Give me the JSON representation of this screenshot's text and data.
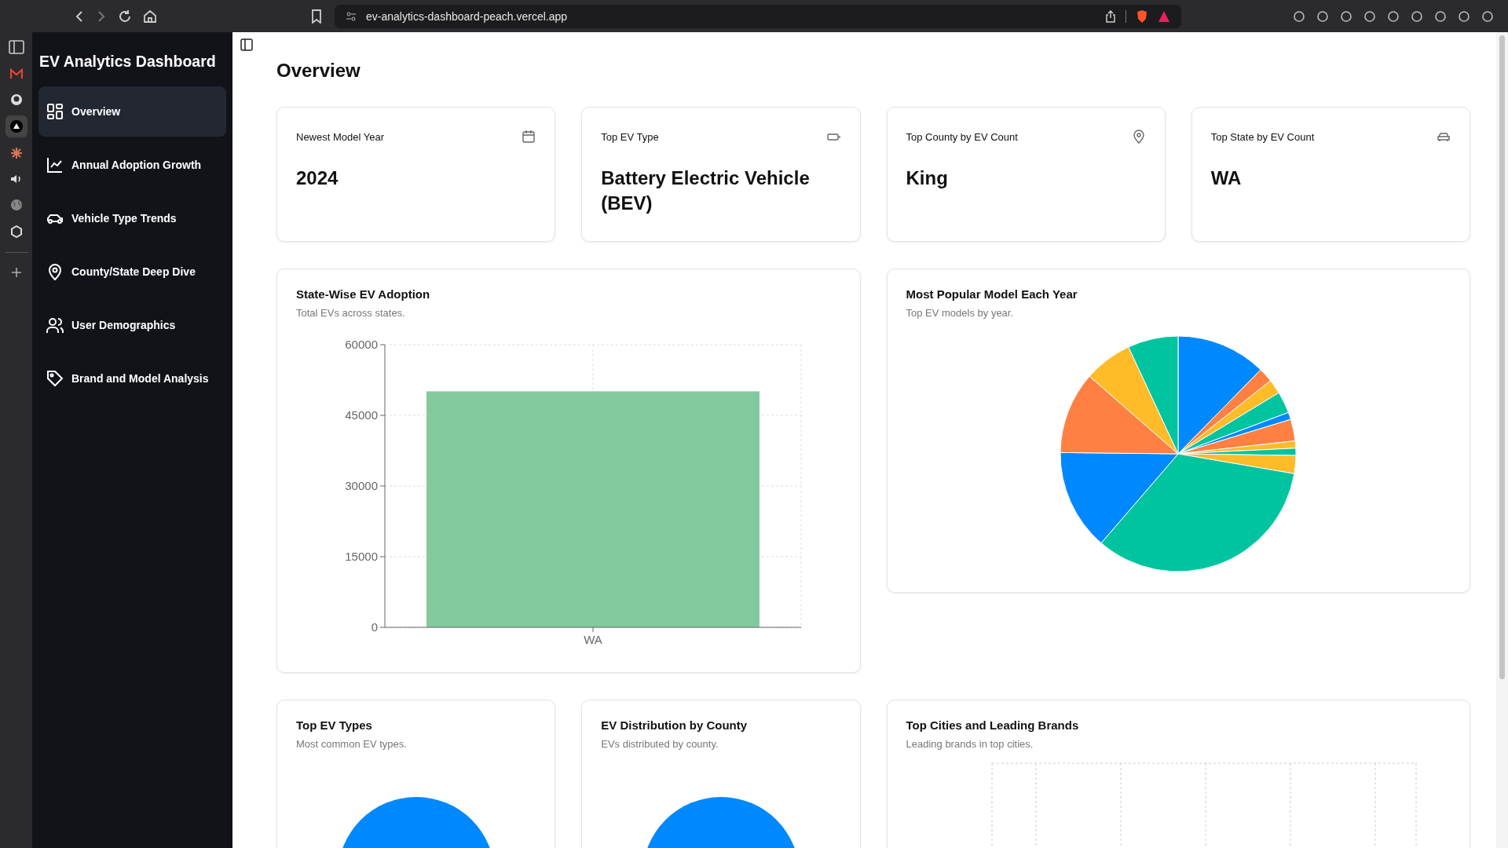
{
  "browser": {
    "url": "ev-analytics-dashboard-peach.vercel.app"
  },
  "sidebar": {
    "title": "EV Analytics Dashboard",
    "items": [
      {
        "label": "Overview",
        "selected": true
      },
      {
        "label": "Annual Adoption Growth",
        "selected": false
      },
      {
        "label": "Vehicle Type Trends",
        "selected": false
      },
      {
        "label": "County/State Deep Dive",
        "selected": false
      },
      {
        "label": "User Demographics",
        "selected": false
      },
      {
        "label": "Brand and Model Analysis",
        "selected": false
      }
    ]
  },
  "page": {
    "title": "Overview"
  },
  "stats": [
    {
      "label": "Newest Model Year",
      "value": "2024"
    },
    {
      "label": "Top EV Type",
      "value": "Battery Electric Vehicle (BEV)"
    },
    {
      "label": "Top County by EV Count",
      "value": "King"
    },
    {
      "label": "Top State by EV Count",
      "value": "WA"
    }
  ],
  "charts": [
    {
      "kind": "bar",
      "title": "State-Wise EV Adoption",
      "subtitle": "Total EVs across states.",
      "chart_data": {
        "type": "bar",
        "categories": [
          "WA"
        ],
        "values": [
          50100
        ],
        "ylim": [
          0,
          60000
        ],
        "yticks": [
          0,
          15000,
          30000,
          45000,
          60000
        ],
        "grid": true
      }
    },
    {
      "kind": "pie",
      "title": "Most Popular Model Each Year",
      "subtitle": "Top EV models by year."
    },
    {
      "kind": "pie",
      "title": "Top EV Types",
      "subtitle": "Most common EV types."
    },
    {
      "kind": "pie",
      "title": "EV Distribution by County",
      "subtitle": "EVs distributed by county."
    },
    {
      "kind": "grid",
      "title": "Top Cities and Leading Brands",
      "subtitle": "Leading brands in top cities."
    }
  ]
}
